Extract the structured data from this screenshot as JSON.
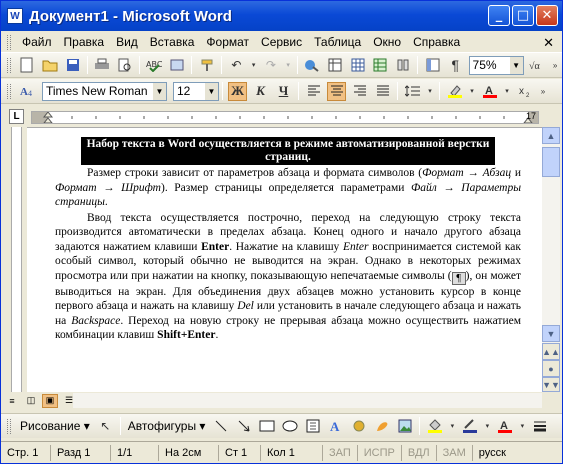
{
  "titlebar": {
    "title": "Документ1 - Microsoft Word",
    "icon": "W"
  },
  "window_buttons": {
    "minimize": "_",
    "maximize": "□",
    "close": "✕"
  },
  "menu": [
    "Файл",
    "Правка",
    "Вид",
    "Вставка",
    "Формат",
    "Сервис",
    "Таблица",
    "Окно",
    "Справка"
  ],
  "menu_close": "✕",
  "standard_toolbar": {
    "zoom": "75%"
  },
  "format_toolbar": {
    "font": "Times New Roman",
    "size": "12",
    "bold": "Ж",
    "italic": "К",
    "underline": "Ч"
  },
  "ruler": {
    "tab_selector": "L",
    "right_number": "17"
  },
  "document": {
    "heading": "Набор текста в Word осуществляется в режиме автоматизированной верстки страниц.",
    "para1": {
      "t1": "Размер строки зависит от параметров абзаца и формата символов (",
      "i1": "Формат → Абзац",
      "t2": " и ",
      "i2": "Формат → Шрифт",
      "t3": "). Размер страницы определяется параметрами ",
      "i3": "Файл → Параметры страницы",
      "t4": "."
    },
    "para2": {
      "t1": "Ввод текста осуществляется построчно, переход на следующую строку текста производится автоматически в пределах абзаца. Конец одного и начало другого абзаца задаются нажатием клавиши ",
      "b1": "Enter",
      "t2": ". Нажатие на клавишу ",
      "i1": "Enter",
      "t3": " воспринимается системой как особый символ, который обычно не выводится на экран. Однако в некоторых режимах просмотра или при нажатии на кнопку, показывающую непечатаемые символы (",
      "mark": "¶",
      "t4": "), он может выводиться на экран. Для объединения двух абзацев можно установить курсор в конце первого абзаца и нажать на клавишу ",
      "i2": "Del",
      "t5": " или установить в начале следующего абзаца и нажать на ",
      "i3": "Backspace",
      "t6": ". Переход на новую строку не прерывая абзаца можно осуществить нажатием комбинации клавиш ",
      "b2": "Shift+Enter",
      "t7": "."
    }
  },
  "drawing_toolbar": {
    "draw": "Рисование ▾",
    "autoshapes": "Автофигуры ▾"
  },
  "status": [
    "Стр. 1",
    "Разд 1",
    "1/1",
    "На 2см",
    "Ст 1",
    "Кол 1"
  ],
  "status_modes": [
    "ЗАП",
    "ИСПР",
    "ВДЛ",
    "ЗАМ"
  ],
  "status_lang": "русск",
  "colors": {
    "title_blue": "#0a49d6",
    "highlight": "#ffff00",
    "font_color": "#ff0000"
  }
}
